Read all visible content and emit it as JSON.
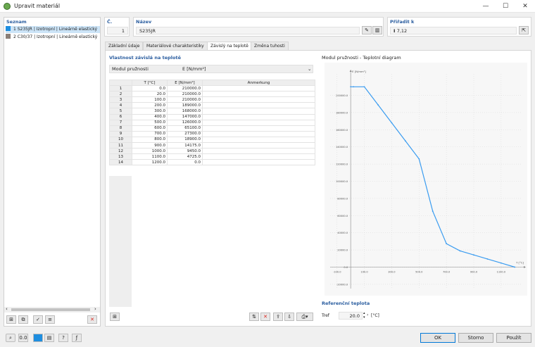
{
  "window": {
    "title": "Upravit materiál",
    "min": "—",
    "max": "☐",
    "close": "✕"
  },
  "list": {
    "header": "Seznam",
    "items": [
      {
        "text": "1  S235JR | Izotropní | Lineárně elastický",
        "color": "#1e8ee0"
      },
      {
        "text": "2  C30/37 | Izotropní | Lineárně elastický",
        "color": "#8a7f78"
      }
    ]
  },
  "number": {
    "label": "Č.",
    "value": "1"
  },
  "name": {
    "label": "Název",
    "value": "S235JR"
  },
  "assign": {
    "label": "Přiřadit k",
    "value": "7,12"
  },
  "tabs": [
    "Základní údaje",
    "Materiálové charakteristiky",
    "Závislý na teplotě",
    "Změna tuhosti"
  ],
  "temp_section": {
    "header": "Vlastnost závislá na teplotě",
    "property": "Modul pružnosti",
    "unit": "E [N/mm²]"
  },
  "table": {
    "headers": [
      "",
      "T [°C]",
      "E [N/mm²]",
      "Anmerkung"
    ],
    "rows": [
      [
        "1",
        "0.0",
        "210000.0",
        ""
      ],
      [
        "2",
        "20.0",
        "210000.0",
        ""
      ],
      [
        "3",
        "100.0",
        "210000.0",
        ""
      ],
      [
        "4",
        "200.0",
        "189000.0",
        ""
      ],
      [
        "5",
        "300.0",
        "168000.0",
        ""
      ],
      [
        "6",
        "400.0",
        "147000.0",
        ""
      ],
      [
        "7",
        "500.0",
        "126000.0",
        ""
      ],
      [
        "8",
        "600.0",
        "65100.0",
        ""
      ],
      [
        "9",
        "700.0",
        "27300.0",
        ""
      ],
      [
        "10",
        "800.0",
        "18900.0",
        ""
      ],
      [
        "11",
        "900.0",
        "14175.0",
        ""
      ],
      [
        "12",
        "1000.0",
        "9450.0",
        ""
      ],
      [
        "13",
        "1100.0",
        "4725.0",
        ""
      ],
      [
        "14",
        "1200.0",
        "0.0",
        ""
      ]
    ]
  },
  "chart_title": "Modul pružnosti - Teplotní diagram",
  "chart_data": {
    "type": "line",
    "x": [
      0,
      20,
      100,
      200,
      300,
      400,
      500,
      600,
      700,
      800,
      900,
      1000,
      1100,
      1200
    ],
    "y": [
      210000,
      210000,
      210000,
      189000,
      168000,
      147000,
      126000,
      65100,
      27300,
      18900,
      14175,
      9450,
      4725,
      0
    ],
    "xlim": [
      -150,
      1250
    ],
    "ylim": [
      -25000,
      225000
    ],
    "xticks": [
      -100,
      100,
      300,
      500,
      700,
      900,
      1100
    ],
    "xtick_labels": [
      "-100.0",
      "100.0",
      "300.0",
      "500.0",
      "700.0",
      "900.0",
      "1100.0"
    ],
    "yticks": [
      -20000,
      0,
      20000,
      40000,
      60000,
      80000,
      100000,
      120000,
      140000,
      160000,
      180000,
      200000
    ],
    "ytick_labels": [
      "-20000.0",
      "0.0",
      "20000.0",
      "40000.0",
      "60000.0",
      "80000.0",
      "100000.0",
      "120000.0",
      "140000.0",
      "160000.0",
      "180000.0",
      "200000.0"
    ],
    "xlabel": "T [°C]",
    "ylabel": "E [N/mm²]",
    "line_color": "#3a9cf0",
    "grid": true
  },
  "ref_temp": {
    "header": "Referenční teplota",
    "label": "Tref",
    "value": "20.0",
    "unit": "[°C]"
  },
  "buttons": {
    "ok": "OK",
    "cancel": "Storno",
    "apply": "Použít"
  }
}
